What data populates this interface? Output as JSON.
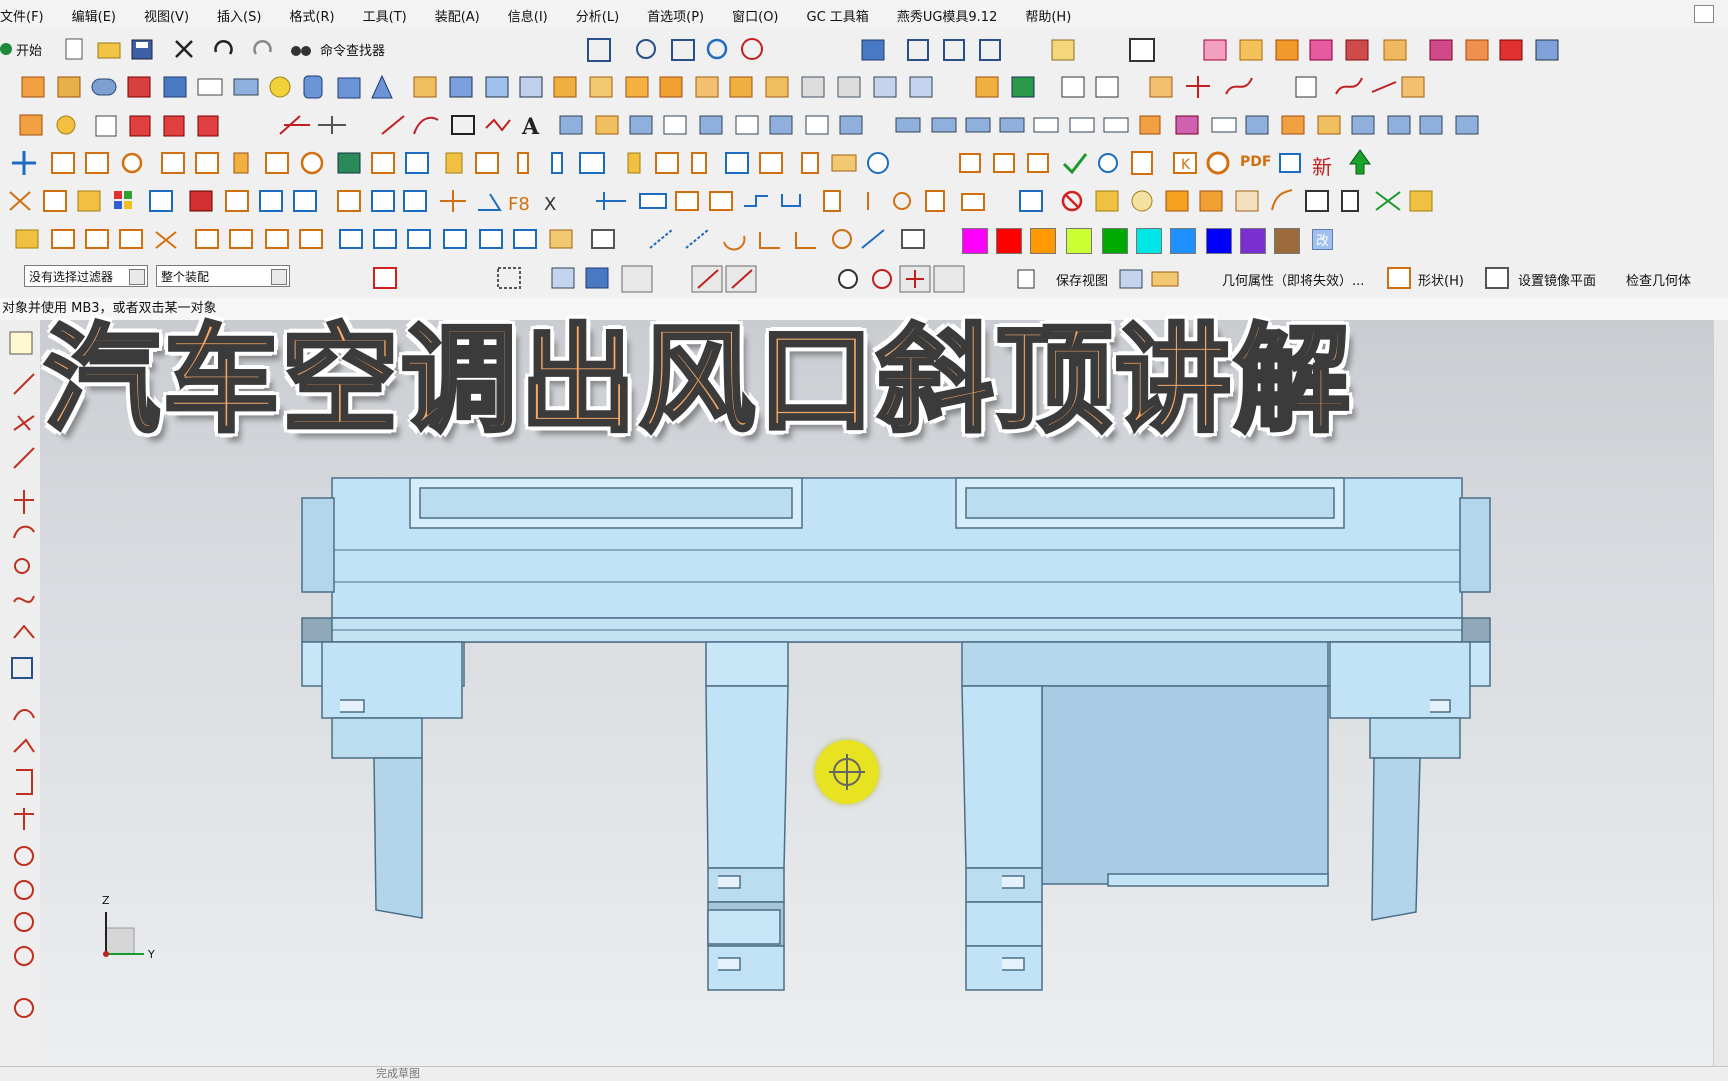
{
  "menu": [
    "文件(F)",
    "编辑(E)",
    "视图(V)",
    "插入(S)",
    "格式(R)",
    "工具(T)",
    "装配(A)",
    "信息(I)",
    "分析(L)",
    "首选项(P)",
    "窗口(O)",
    "GC 工具箱",
    "燕秀UG模具9.12",
    "帮助(H)"
  ],
  "toolbar": {
    "start_label": "开始",
    "cmd_finder_label": "命令查找器",
    "pdf_label": "PDF",
    "new_label": "新",
    "change_label": "改"
  },
  "swatches": [
    "#ff00ff",
    "#ff0000",
    "#ff9900",
    "#ccff33",
    "#00aa00",
    "#00e5e5",
    "#1e90ff",
    "#0000ff",
    "#7a30d0",
    "#9a6a3a"
  ],
  "selection_bar": {
    "filter_value": "没有选择过滤器",
    "scope_value": "整个装配",
    "save_view_label": "保存视图",
    "geom_props_label": "几何属性（即将失效）...",
    "shape_label": "形状(H)",
    "mirror_plane_label": "设置镜像平面",
    "check_geometry_label": "检查几何体"
  },
  "status_text": "对象并使用 MB3，或者双击某一对象",
  "overlay_title": "汽车空调出风口斜顶讲解",
  "triad": {
    "z": "Z",
    "y": "Y"
  },
  "bottom_status": "完成草图",
  "colors": {
    "part_fill": "#c2e2f5",
    "part_stroke": "#4c6e86",
    "title_fill": "#f6a866",
    "cursor": "#e8e320"
  }
}
